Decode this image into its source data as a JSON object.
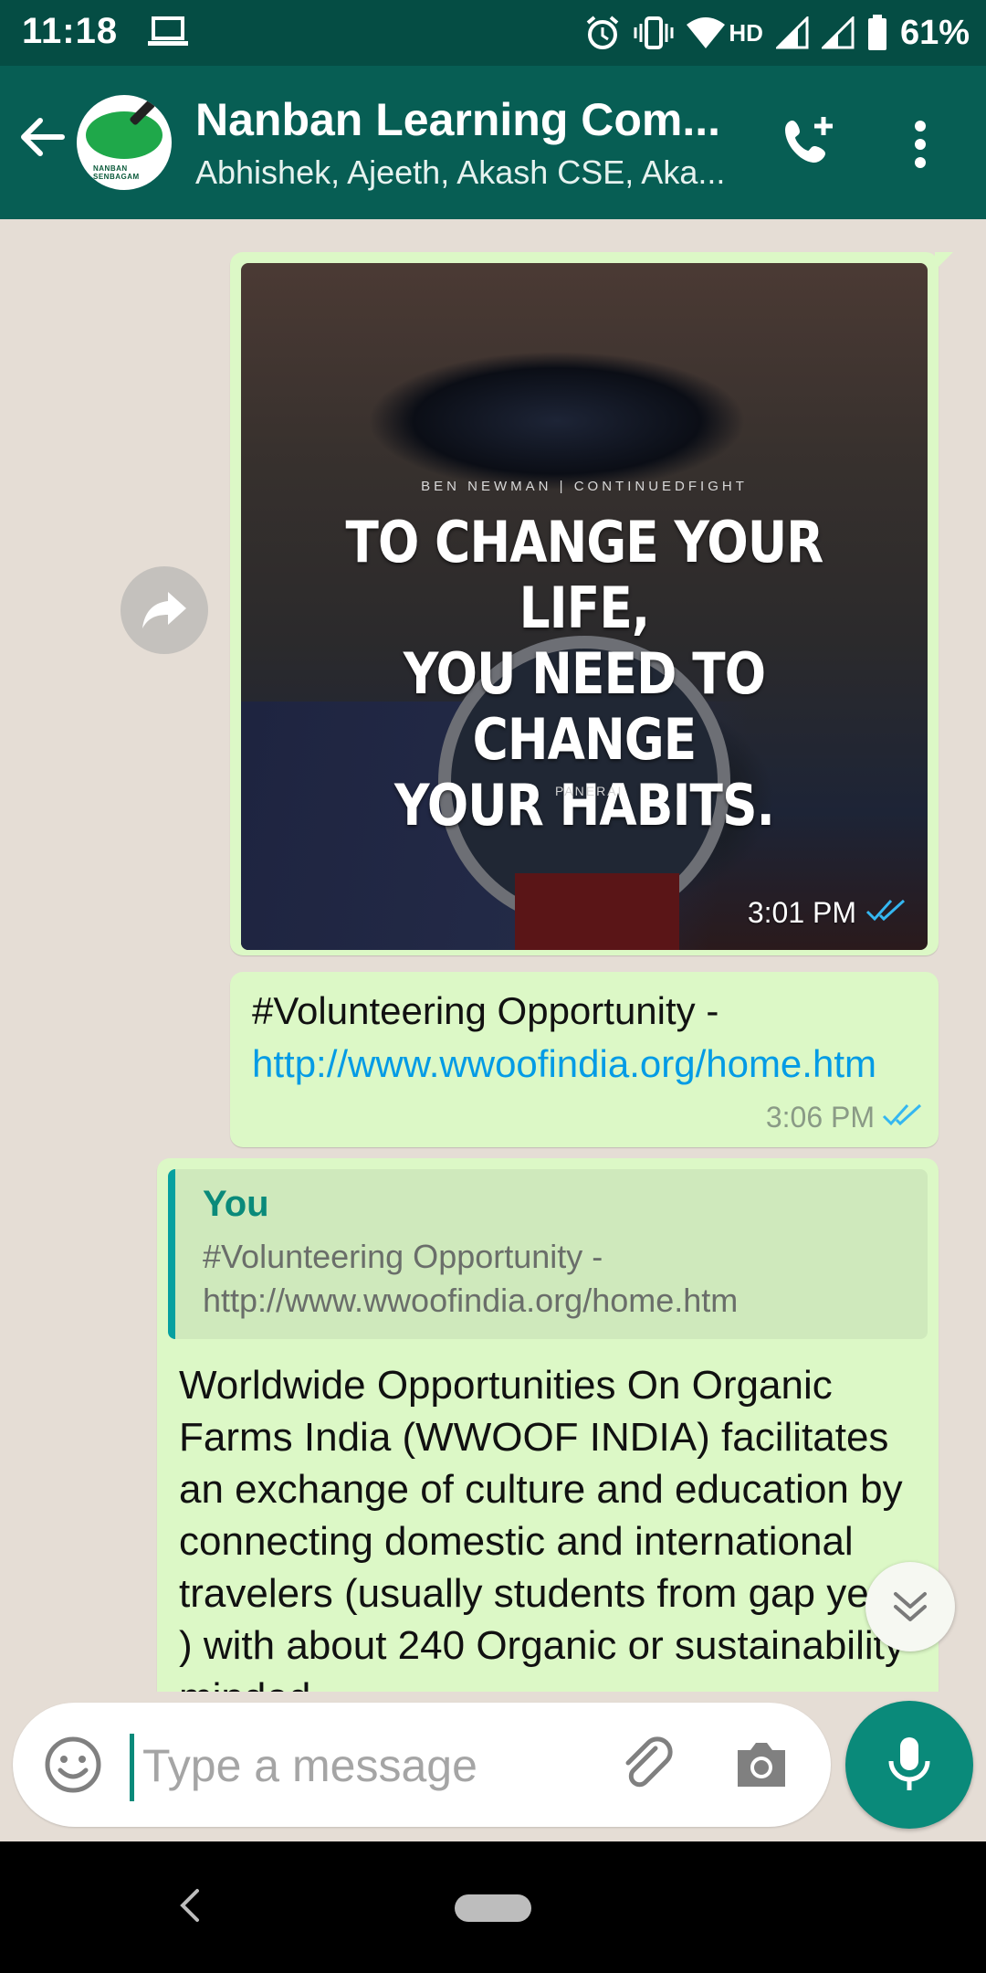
{
  "status_bar": {
    "time": "11:18",
    "network_label": "HD",
    "battery": "61%",
    "icons": [
      "laptop-icon",
      "alarm-icon",
      "vibrate-icon",
      "wifi-icon",
      "signal-icon",
      "signal-icon",
      "battery-icon"
    ]
  },
  "header": {
    "title": "Nanban Learning Com...",
    "subtitle": "Abhishek, Ajeeth, Akash CSE, Aka...",
    "avatar_text": "NANBAN SENBAGAM",
    "icons": [
      "back-arrow-icon",
      "add-call-icon",
      "more-vert-icon"
    ]
  },
  "messages": [
    {
      "type": "image",
      "image_credit": "BEN NEWMAN | CONTINUEDFIGHT",
      "image_quote_lines": [
        "TO CHANGE YOUR LIFE,",
        "YOU NEED TO CHANGE",
        "YOUR HABITS."
      ],
      "image_brand": "PANERAI",
      "time": "3:01 PM",
      "status": "read"
    },
    {
      "type": "text",
      "text": "#Volunteering Opportunity - ",
      "link": "http://www.wwoofindia.org/home.htm",
      "time": "3:06 PM",
      "status": "read"
    },
    {
      "type": "reply",
      "quoted_author": "You",
      "quoted_text_line1": "#Volunteering Opportunity -",
      "quoted_text_line2": "http://www.wwoofindia.org/home.htm",
      "text": "Worldwide Opportunities On Organic Farms India (WWOOF INDIA) facilitates an exchange of culture and education by connecting domestic and international travelers (usually students from gap year ) with about 240 Organic or sustainability-minded"
    }
  ],
  "composer": {
    "placeholder": "Type a message"
  },
  "colors": {
    "header": "#075e54",
    "status_bar": "#054d44",
    "outgoing_bubble": "#dcf8c6",
    "chat_background": "#e5ddd5",
    "accent": "#0a8a7a",
    "link": "#039be5",
    "read_ticks": "#34b7f1"
  }
}
